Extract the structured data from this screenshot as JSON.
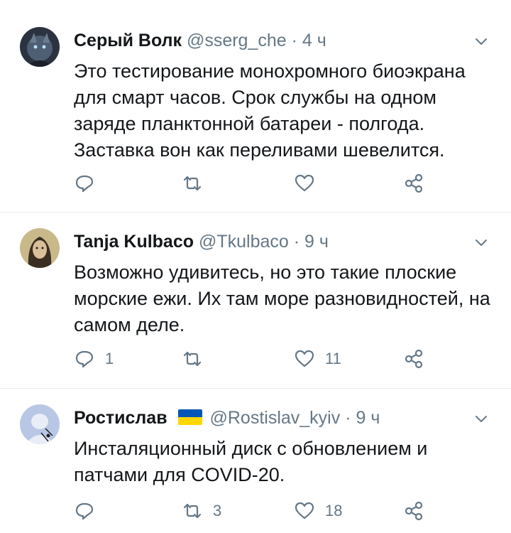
{
  "tweets": [
    {
      "name": "Серый Волк",
      "handle": "@sserg_che",
      "dot": "·",
      "time": "4 ч",
      "text": "Это тестирование монохромного биоэкрана для смарт часов. Срок службы на одном заряде планктонной батареи - полгода. Заставка вон как переливами шевелится.",
      "replies": "",
      "retweets": "",
      "likes": ""
    },
    {
      "name": "Tanja Kulbaco",
      "handle": "@Tkulbaco",
      "dot": "·",
      "time": "9 ч",
      "text": "Возможно удивитесь, но это такие плоские морские ежи. Их там море разновидностей, на самом деле.",
      "replies": "1",
      "retweets": "",
      "likes": "11"
    },
    {
      "name": "Ростислав",
      "handle": "@Rostislav_kyiv",
      "dot": "·",
      "time": "9 ч",
      "text": "Инсталяционный диск с обновлением и патчами для COVID-20.",
      "replies": "",
      "retweets": "3",
      "likes": "18"
    }
  ],
  "icons": {
    "reply": "reply-icon",
    "retweet": "retweet-icon",
    "like": "heart-icon",
    "share": "share-icon",
    "more": "chevron-down-icon"
  },
  "colors": {
    "text": "#14171a",
    "secondary": "#657786",
    "divider": "#e6ecf0",
    "flag_blue": "#0057b7",
    "flag_yellow": "#ffd700"
  }
}
